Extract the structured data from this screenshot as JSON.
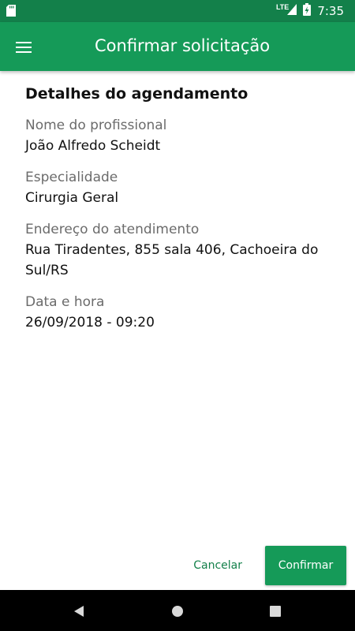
{
  "status_bar": {
    "network_label": "LTE",
    "time": "7:35",
    "icons": [
      "sd-card-icon",
      "signal-icon",
      "battery-charging-icon"
    ]
  },
  "app_bar": {
    "menu_icon": "hamburger-menu-icon",
    "title": "Confirmar solicitação"
  },
  "details": {
    "section_title": "Detalhes do agendamento",
    "fields": [
      {
        "label": "Nome do profissional",
        "value": "João Alfredo Scheidt"
      },
      {
        "label": "Especialidade",
        "value": "Cirurgia Geral"
      },
      {
        "label": "Endereço do atendimento",
        "value": "Rua Tiradentes, 855 sala 406, Cachoeira do Sul/RS"
      },
      {
        "label": "Data e hora",
        "value": "26/09/2018 - 09:20"
      }
    ]
  },
  "actions": {
    "cancel_label": "Cancelar",
    "confirm_label": "Confirmar"
  },
  "nav_bar": {
    "icons": [
      "back-icon",
      "home-icon",
      "recents-icon"
    ]
  },
  "colors": {
    "status_bar": "#13804a",
    "app_bar": "#159a58",
    "accent_text": "#13804a"
  }
}
